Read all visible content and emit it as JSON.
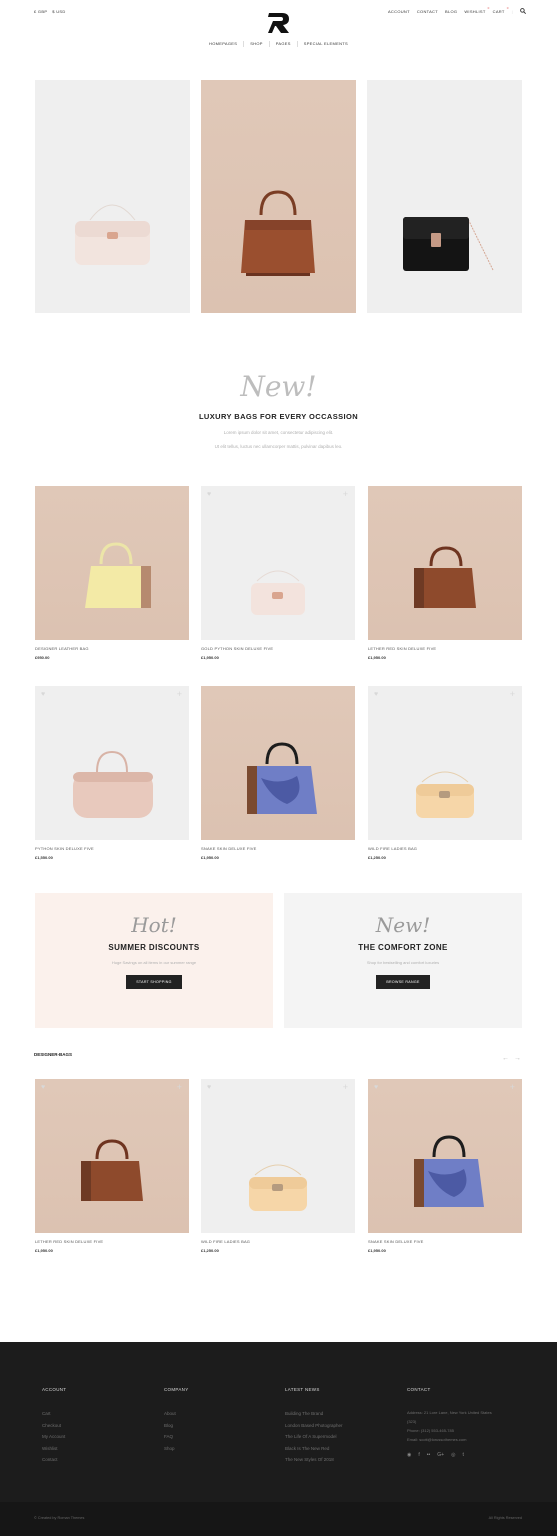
{
  "header": {
    "currencies": [
      "£ GBP",
      "$ USD"
    ],
    "topnav": [
      "ACCOUNT",
      "CONTACT",
      "BLOG",
      "WISHLIST",
      "CART"
    ],
    "wishlist_count": "0",
    "cart_count": "0",
    "mainnav": [
      "HOMEPAGES",
      "SHOP",
      "PAGES",
      "SPECIAL ELEMENTS"
    ]
  },
  "intro": {
    "script": "New!",
    "title": "LUXURY BAGS FOR EVERY OCCASSION",
    "line1": "Lorem ipsum dolor sit amet, consectetur adipiscing elit.",
    "line2": "Ut elit tellus, luctus nec ullamcorper mattis, pulvinar dapibus leo."
  },
  "products": [
    {
      "name": "DESIGNER LEATHER BAG",
      "price": "£950.00"
    },
    {
      "name": "GOLD PYTHON SKIN DELUXE FIVE",
      "price": "£1,950.00"
    },
    {
      "name": "LETHER RED SKIN DELUXE FIVE",
      "price": "£1,950.00"
    },
    {
      "name": "PYTHON SKIN DELUXE FIVE",
      "price": "£1,550.00"
    },
    {
      "name": "SNAKE SKIN DELUXE FIVE",
      "price": "£1,950.00"
    },
    {
      "name": "WILD FIRE LADIES BAG",
      "price": "£1,250.00"
    }
  ],
  "promos": [
    {
      "script": "Hot!",
      "title": "SUMMER DISCOUNTS",
      "text": "Huge Savings on all items in our summer range",
      "button": "START SHOPPING"
    },
    {
      "script": "New!",
      "title": "THE COMFORT ZONE",
      "text": "Shop for bestselling and comfort luxuries",
      "button": "BROWSE RANGE"
    }
  ],
  "designer": {
    "label": "DESIGNER-BAGS",
    "arrows": [
      "←",
      "→"
    ],
    "products": [
      {
        "name": "LETHER RED SKIN DELUXE FIVE",
        "price": "£1,950.00"
      },
      {
        "name": "WILD FIRE LADIES BAG",
        "price": "£1,250.00"
      },
      {
        "name": "SNAKE SKIN DELUXE FIVE",
        "price": "£1,950.00"
      }
    ]
  },
  "footer": {
    "account": {
      "title": "ACCOUNT",
      "items": [
        "Cart",
        "Checkout",
        "My Account",
        "Wishlist",
        "Contact"
      ]
    },
    "company": {
      "title": "COMPANY",
      "items": [
        "About",
        "Blog",
        "FAQ",
        "Shop"
      ]
    },
    "news": {
      "title": "LATEST NEWS",
      "items": [
        "Building The Brand",
        "London Based Photographer",
        "The Life Of A Supermodel",
        "Black Is The New Red",
        "The New Styles Of 2018"
      ]
    },
    "contact": {
      "title": "CONTACT",
      "address": "Address: 21 Lore Lane, New York United States",
      "zip": "(323)",
      "phone": "Phone: (312) 553-465-785",
      "email": "Email: scott@lorussothemes.com"
    },
    "social_icons": [
      "dribbble-icon",
      "facebook-icon",
      "flickr-icon",
      "google-plus-icon",
      "instagram-icon",
      "twitter-icon"
    ],
    "social_glyphs": [
      "◉",
      "f",
      "••",
      "G+",
      "◎",
      "t"
    ],
    "copyright": "©  Created by Roman Themes",
    "rights": "All Rights Reserved"
  }
}
